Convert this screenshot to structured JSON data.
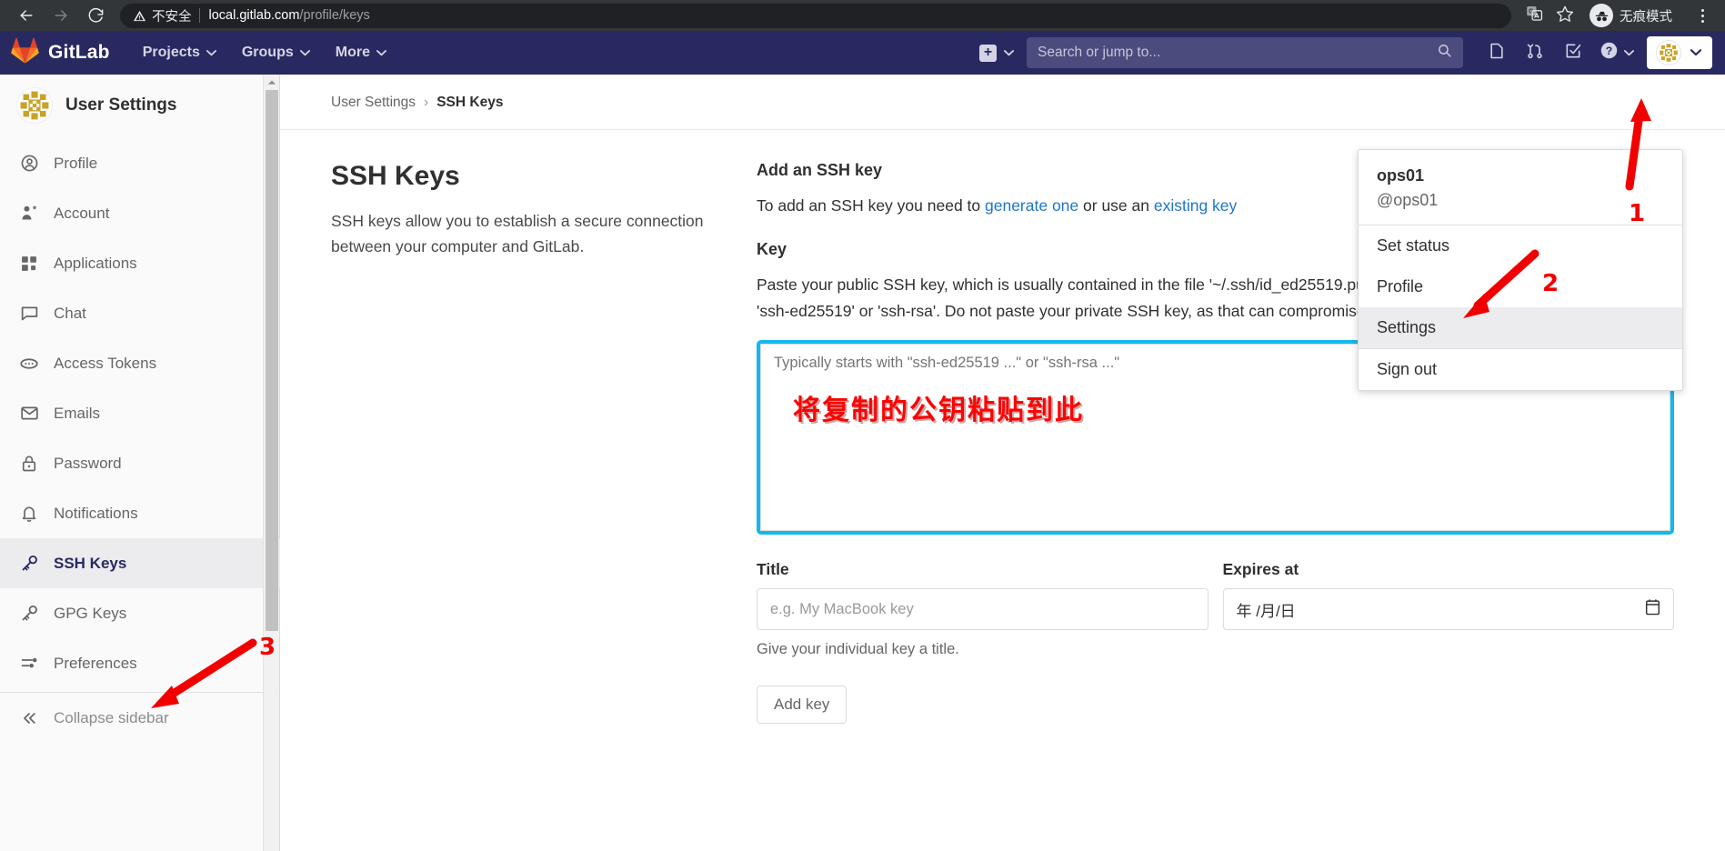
{
  "browser": {
    "back_icon": "back-arrow-icon",
    "forward_icon": "forward-arrow-icon",
    "reload_icon": "reload-icon",
    "security_warning": "不安全",
    "url_host": "local.gitlab.com",
    "url_path": "/profile/keys",
    "translate_icon": "translate-icon",
    "bookmark_icon": "star-icon",
    "incognito_label": "无痕模式",
    "menu_icon": "kebab-menu-icon"
  },
  "navbar": {
    "brand": "GitLab",
    "logo_icon": "gitlab-tanuki-icon",
    "items": [
      {
        "label": "Projects"
      },
      {
        "label": "Groups"
      },
      {
        "label": "More"
      }
    ],
    "create_new_icon": "plus-square-icon",
    "search": {
      "placeholder": "Search or jump to...",
      "icon": "search-icon"
    },
    "icons": [
      {
        "name": "issues-icon"
      },
      {
        "name": "merge-requests-icon"
      },
      {
        "name": "todos-icon"
      },
      {
        "name": "help-icon"
      }
    ],
    "avatar_icon": "user-avatar-icon"
  },
  "user_menu": {
    "name": "ops01",
    "handle": "@ops01",
    "items": [
      {
        "label": "Set status",
        "highlighted": false
      },
      {
        "label": "Profile",
        "highlighted": false
      },
      {
        "label": "Settings",
        "highlighted": true
      },
      {
        "label": "Sign out",
        "highlighted": false
      }
    ]
  },
  "sidebar": {
    "title": "User Settings",
    "avatar_icon": "user-avatar-icon",
    "items": [
      {
        "label": "Profile",
        "icon": "profile-icon",
        "active": false
      },
      {
        "label": "Account",
        "icon": "account-icon",
        "active": false
      },
      {
        "label": "Applications",
        "icon": "applications-icon",
        "active": false
      },
      {
        "label": "Chat",
        "icon": "chat-icon",
        "active": false
      },
      {
        "label": "Access Tokens",
        "icon": "access-tokens-icon",
        "active": false
      },
      {
        "label": "Emails",
        "icon": "email-icon",
        "active": false
      },
      {
        "label": "Password",
        "icon": "lock-icon",
        "active": false
      },
      {
        "label": "Notifications",
        "icon": "bell-icon",
        "active": false
      },
      {
        "label": "SSH Keys",
        "icon": "key-icon",
        "active": true
      },
      {
        "label": "GPG Keys",
        "icon": "key-icon",
        "active": false
      },
      {
        "label": "Preferences",
        "icon": "preferences-icon",
        "active": false
      }
    ],
    "collapse_label": "Collapse sidebar",
    "collapse_icon": "collapse-chevrons-icon"
  },
  "breadcrumb": {
    "root": "User Settings",
    "separator": "›",
    "current": "SSH Keys"
  },
  "main": {
    "left": {
      "heading": "SSH Keys",
      "description": "SSH keys allow you to establish a secure connection between your computer and GitLab."
    },
    "right": {
      "add_heading": "Add an SSH key",
      "add_text_before": "To add an SSH key you need to ",
      "link_generate": "generate one",
      "add_text_middle": " or use an ",
      "link_existing": "existing key",
      "key_heading": "Key",
      "key_help": "Paste your public SSH key, which is usually contained in the file '~/.ssh/id_ed25519.pub' or '~/.ssh/id_rsa.pub' and begins with 'ssh-ed25519' or 'ssh-rsa'. Do not paste your private SSH key, as that can compromise your identity.",
      "key_placeholder": "Typically starts with \"ssh-ed25519 ...\" or \"ssh-rsa ...\"",
      "title_label": "Title",
      "title_placeholder": "e.g. My MacBook key",
      "title_help": "Give your individual key a title.",
      "expires_label": "Expires at",
      "expires_placeholder": "年 /月/日",
      "calendar_icon": "calendar-icon",
      "submit_label": "Add key"
    }
  },
  "annotations": {
    "chinese_note": "将复制的公钥粘贴到此",
    "markers": [
      {
        "label": "1"
      },
      {
        "label": "2"
      },
      {
        "label": "3"
      }
    ],
    "arrow_color": "#f20000",
    "highlight_box_color": "#15b7f0"
  }
}
